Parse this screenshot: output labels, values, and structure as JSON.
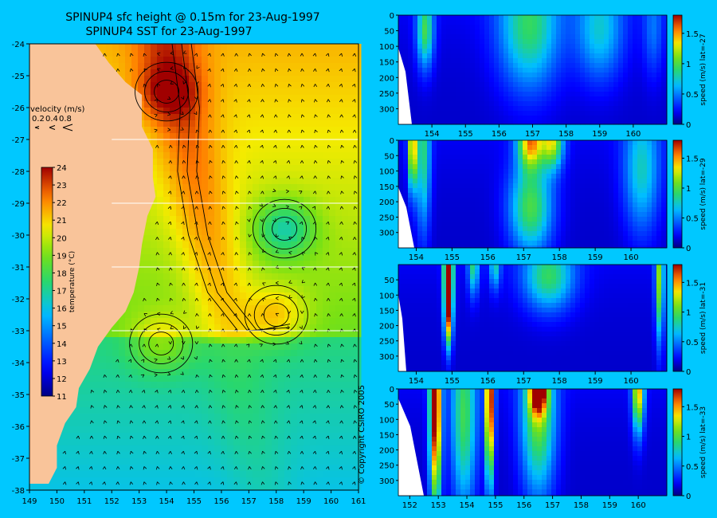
{
  "titles": {
    "line1": "SPINUP4 sfc height @ 0.15m for 23-Aug-1997",
    "line2": "SPINUP4 SST for 23-Aug-1997"
  },
  "copyright": "© Copyright CSIRO 2005",
  "velocity_legend": {
    "title": "velocity (m/s)",
    "values": [
      "0.2",
      "0.4",
      "0.8"
    ]
  },
  "colors": {
    "background": "#00c8ff",
    "land": "#f9c49a",
    "contour": "#000000"
  },
  "chart_data": [
    {
      "type": "heatmap",
      "name": "sst-map",
      "title": "SPINUP4 sfc height @ 0.15m for 23-Aug-1997 / SPINUP4 SST for 23-Aug-1997",
      "xlabel": "",
      "ylabel": "",
      "xlim": [
        149,
        161
      ],
      "ylim": [
        -38,
        -24
      ],
      "xticks": [
        149,
        150,
        151,
        152,
        153,
        154,
        155,
        156,
        157,
        158,
        159,
        160,
        161
      ],
      "yticks": [
        -24,
        -25,
        -26,
        -27,
        -28,
        -29,
        -30,
        -31,
        -32,
        -33,
        -34,
        -35,
        -36,
        -37,
        -38
      ],
      "colorbar": {
        "label": "temperature (°C)",
        "range": [
          11,
          24
        ],
        "ticks": [
          11,
          12,
          13,
          14,
          15,
          16,
          17,
          18,
          19,
          20,
          21,
          22,
          23,
          24
        ]
      },
      "section_latitudes": [
        -27,
        -29,
        -31,
        -33
      ],
      "eddies": [
        {
          "lon": 158.3,
          "lat": -29.8,
          "kind": "cold core"
        },
        {
          "lon": 153.8,
          "lat": -33.4,
          "kind": "warm core"
        },
        {
          "lon": 158.0,
          "lat": -32.5,
          "kind": "warm core"
        },
        {
          "lon": 154.0,
          "lat": -25.5,
          "kind": "warm core"
        }
      ]
    },
    {
      "type": "heatmap",
      "name": "section-lat-27",
      "xlim": [
        153.0,
        161.0
      ],
      "xticks": [
        154,
        155,
        156,
        157,
        158,
        159,
        160
      ],
      "ylim": [
        350,
        0
      ],
      "yticks": [
        0,
        50,
        100,
        150,
        200,
        250,
        300
      ],
      "colorbar": {
        "label": "speed (m/s) lat=-27",
        "range": [
          0,
          1.8
        ],
        "ticks": [
          0,
          0.5,
          1,
          1.5
        ]
      },
      "cores": [
        {
          "lon": 153.8,
          "depth": 50,
          "speed": 0.8,
          "half_width": 0.25,
          "depth_scale": 120
        },
        {
          "lon": 156.9,
          "depth": 40,
          "speed": 0.75,
          "half_width": 0.9,
          "depth_scale": 200
        },
        {
          "lon": 159.0,
          "depth": 50,
          "speed": 0.55,
          "half_width": 0.7,
          "depth_scale": 160
        },
        {
          "lon": 160.6,
          "depth": 50,
          "speed": 0.3,
          "half_width": 0.3,
          "depth_scale": 150
        }
      ]
    },
    {
      "type": "heatmap",
      "name": "section-lat-29",
      "xlim": [
        153.5,
        161.0
      ],
      "xticks": [
        154,
        155,
        156,
        157,
        158,
        159,
        160
      ],
      "ylim": [
        350,
        0
      ],
      "yticks": [
        0,
        50,
        100,
        150,
        200,
        250,
        300
      ],
      "colorbar": {
        "label": "speed (m/s) lat=-29",
        "range": [
          0,
          1.8
        ],
        "ticks": [
          0,
          0.5,
          1,
          1.5
        ]
      },
      "cores": [
        {
          "lon": 153.9,
          "depth": 20,
          "speed": 1.35,
          "half_width": 0.12,
          "depth_scale": 140
        },
        {
          "lon": 154.2,
          "depth": 50,
          "speed": 0.7,
          "half_width": 0.2,
          "depth_scale": 250
        },
        {
          "lon": 157.2,
          "depth": 0,
          "speed": 1.3,
          "half_width": 0.35,
          "depth_scale": 90
        },
        {
          "lon": 157.8,
          "depth": 0,
          "speed": 1.05,
          "half_width": 0.3,
          "depth_scale": 90
        },
        {
          "lon": 157.2,
          "depth": 220,
          "speed": 0.85,
          "half_width": 0.6,
          "depth_scale": 150
        },
        {
          "lon": 160.3,
          "depth": 100,
          "speed": 0.6,
          "half_width": 0.5,
          "depth_scale": 200
        }
      ]
    },
    {
      "type": "heatmap",
      "name": "section-lat-31",
      "xlim": [
        153.5,
        161.0
      ],
      "xticks": [
        154,
        155,
        156,
        157,
        158,
        159,
        160
      ],
      "ylim": [
        350,
        0
      ],
      "yticks": [
        50,
        100,
        150,
        200,
        250,
        300
      ],
      "colorbar": {
        "label": "speed (m/s) lat=-31",
        "range": [
          0,
          1.8
        ],
        "ticks": [
          0,
          0.5,
          1,
          1.5
        ]
      },
      "cores": [
        {
          "lon": 154.9,
          "depth": 0,
          "speed": 1.7,
          "half_width": 0.13,
          "depth_scale": 160
        },
        {
          "lon": 154.9,
          "depth": 170,
          "speed": 1.1,
          "half_width": 0.11,
          "depth_scale": 110
        },
        {
          "lon": 155.6,
          "depth": 0,
          "speed": 0.7,
          "half_width": 0.15,
          "depth_scale": 100
        },
        {
          "lon": 156.2,
          "depth": 0,
          "speed": 0.6,
          "half_width": 0.15,
          "depth_scale": 80
        },
        {
          "lon": 157.7,
          "depth": 40,
          "speed": 0.75,
          "half_width": 0.7,
          "depth_scale": 110
        },
        {
          "lon": 160.8,
          "depth": 50,
          "speed": 1.0,
          "half_width": 0.12,
          "depth_scale": 200
        }
      ]
    },
    {
      "type": "heatmap",
      "name": "section-lat-33",
      "xlim": [
        151.6,
        161.0
      ],
      "xticks": [
        152,
        153,
        154,
        155,
        156,
        157,
        158,
        159,
        160
      ],
      "ylim": [
        350,
        0
      ],
      "yticks": [
        0,
        50,
        100,
        150,
        200,
        250,
        300
      ],
      "colorbar": {
        "label": "speed (m/s) lat=-33",
        "range": [
          0,
          1.8
        ],
        "ticks": [
          0,
          0.5,
          1,
          1.5
        ]
      },
      "cores": [
        {
          "lon": 152.9,
          "depth": 60,
          "speed": 1.85,
          "half_width": 0.2,
          "depth_scale": 320
        },
        {
          "lon": 154.8,
          "depth": 40,
          "speed": 1.8,
          "half_width": 0.15,
          "depth_scale": 260
        },
        {
          "lon": 153.9,
          "depth": 100,
          "speed": 0.8,
          "half_width": 0.45,
          "depth_scale": 300
        },
        {
          "lon": 156.5,
          "depth": 0,
          "speed": 1.55,
          "half_width": 0.3,
          "depth_scale": 80
        },
        {
          "lon": 156.5,
          "depth": 100,
          "speed": 0.9,
          "half_width": 0.6,
          "depth_scale": 250
        },
        {
          "lon": 160.0,
          "depth": 0,
          "speed": 1.3,
          "half_width": 0.2,
          "depth_scale": 140
        }
      ]
    }
  ]
}
